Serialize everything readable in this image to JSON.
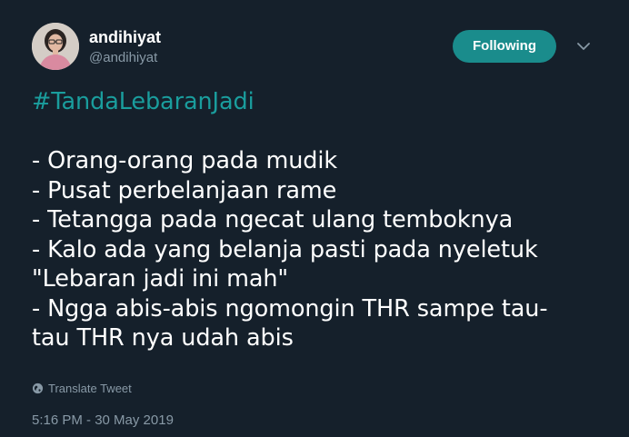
{
  "user": {
    "display_name": "andihiyat",
    "handle": "@andihiyat"
  },
  "follow_button": {
    "label": "Following"
  },
  "tweet": {
    "hashtag": "#TandaLebaranJadi",
    "lines": [
      "- Orang-orang pada mudik",
      "- Pusat perbelanjaan rame",
      "- Tetangga pada ngecat ulang temboknya",
      "- Kalo ada yang belanja pasti pada nyeletuk",
      "\"Lebaran jadi ini mah\"",
      "- Ngga abis-abis ngomongin THR sampe tau-",
      "tau THR nya udah abis"
    ]
  },
  "translate": {
    "label": "Translate Tweet"
  },
  "timestamp": "5:16 PM - 30 May 2019",
  "colors": {
    "background": "#15202b",
    "accent": "#1a8c8c",
    "hashtag": "#1a9d9d",
    "secondary_text": "#8899a6"
  },
  "icons": {
    "caret": "chevron-down-icon",
    "translate": "globe-icon"
  }
}
